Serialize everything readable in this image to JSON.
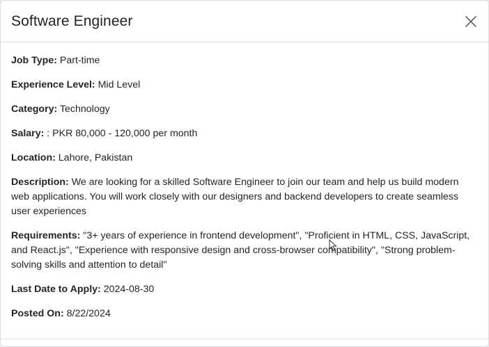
{
  "modal": {
    "title": "Software Engineer",
    "close_icon": "close-icon"
  },
  "details": [
    {
      "label": "Job Type:",
      "value": " Part-time"
    },
    {
      "label": "Experience Level:",
      "value": " Mid Level"
    },
    {
      "label": "Category:",
      "value": " Technology"
    },
    {
      "label": "Salary:",
      "value": " : PKR 80,000 - 120,000 per month"
    },
    {
      "label": "Location:",
      "value": " Lahore, Pakistan"
    },
    {
      "label": "Description:",
      "value": " We are looking for a skilled Software Engineer to join our team and help us build modern web applications. You will work closely with our designers and backend developers to create seamless user experiences"
    },
    {
      "label": "Requirements:",
      "value": " \"3+ years of experience in frontend development\", \"Proficient in HTML, CSS, JavaScript, and React.js\", \"Experience with responsive design and cross-browser compatibility\", \"Strong problem-solving skills and attention to detail\""
    },
    {
      "label": "Last Date to Apply:",
      "value": " 2024-08-30"
    },
    {
      "label": "Posted On:",
      "value": " 8/22/2024"
    }
  ]
}
